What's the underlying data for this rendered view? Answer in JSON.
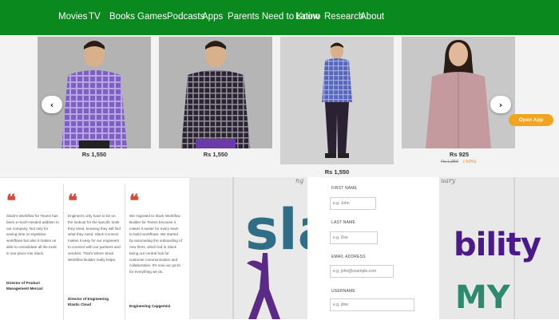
{
  "nav": {
    "items": [
      "Movies",
      "TV",
      "Books",
      "Games",
      "Podcasts",
      "Apps",
      "Parents Need to Know",
      "Latino",
      "Research",
      "About"
    ]
  },
  "carousel": {
    "products": [
      {
        "price": "Rs 1,550",
        "shirt_color": "#7e5fc2"
      },
      {
        "price": "Rs 1,550",
        "shirt_color": "#2b2233"
      },
      {
        "price": "Rs 1,550",
        "shirt_color": "#5866b8"
      },
      {
        "price": "Rs 925",
        "old_price": "Rs 1,850",
        "discount": "(-50%)",
        "shirt_color": "#c59a9f"
      }
    ],
    "prev_icon": "chevron-left-icon",
    "next_icon": "chevron-right-icon",
    "open_app_label": "Open App"
  },
  "testimonials": [
    {
      "body": "Slack's Workflow for Teams has been a much-needed addition to our company. Not only for saving time on repetitive workflows but also it makes us able to consolidate all the tools in one place into Slack.",
      "author": "Director of Product Management Mercari"
    },
    {
      "body": "Engineers only have to be on the lookout for the specific tools they need, knowing they will find what they need. Slack Connect makes it easy for our engineers to connect with our partners and vendors. That's where Slack Workflow Builder really helps.",
      "author": "Director of Engineering Elastic Cloud"
    },
    {
      "body": "We migrated to Slack Workflow Builder for Teams because it makes it easier for every team to build workflows. We started by automating the onboarding of new hires, which led to Slack being our central hub for customer communication and collaboration. It's now our go-to for everything we do.",
      "author": "Engineering Capgemini"
    }
  ],
  "slack_panel": {
    "corner_text": "ng"
  },
  "form": {
    "fields": [
      {
        "label": "FIRST NAME",
        "placeholder": "e.g. John"
      },
      {
        "label": "LAST NAME",
        "placeholder": "e.g. Doe"
      },
      {
        "label": "EMAIL ADDRESS",
        "placeholder": "e.g. john@example.com"
      },
      {
        "label": "USERNAME",
        "placeholder": "e.g. jdoe"
      }
    ]
  },
  "ability_panel": {
    "text": "bility",
    "text2": "MY",
    "corner_text": "uary"
  },
  "colors": {
    "nav_bg": "#0a8a1e",
    "quote_red": "#d64a3a",
    "open_app": "#f2a41f",
    "price_text": "#333333"
  }
}
